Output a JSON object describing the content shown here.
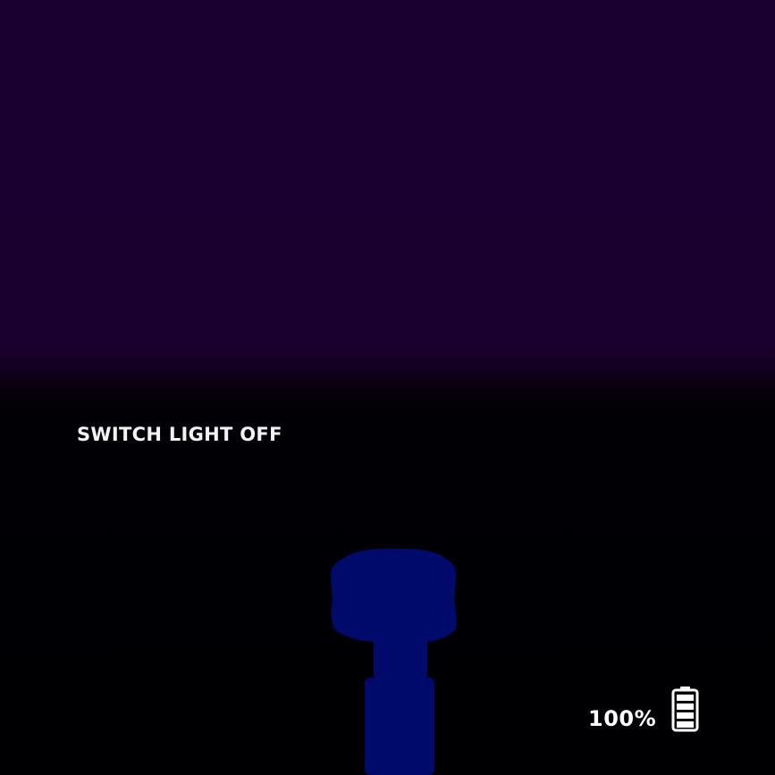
{
  "hud": {
    "prompt": "SWITCH LIGHT OFF",
    "battery_percent_text": "100%",
    "battery_level": 1.0,
    "battery_icon": "battery-full-icon",
    "flashlight_icon": "flashlight-icon"
  },
  "colors": {
    "sky": "#1a0030",
    "ground": "#000003",
    "flashlight": "#000a6a",
    "text": "#ffffff"
  }
}
